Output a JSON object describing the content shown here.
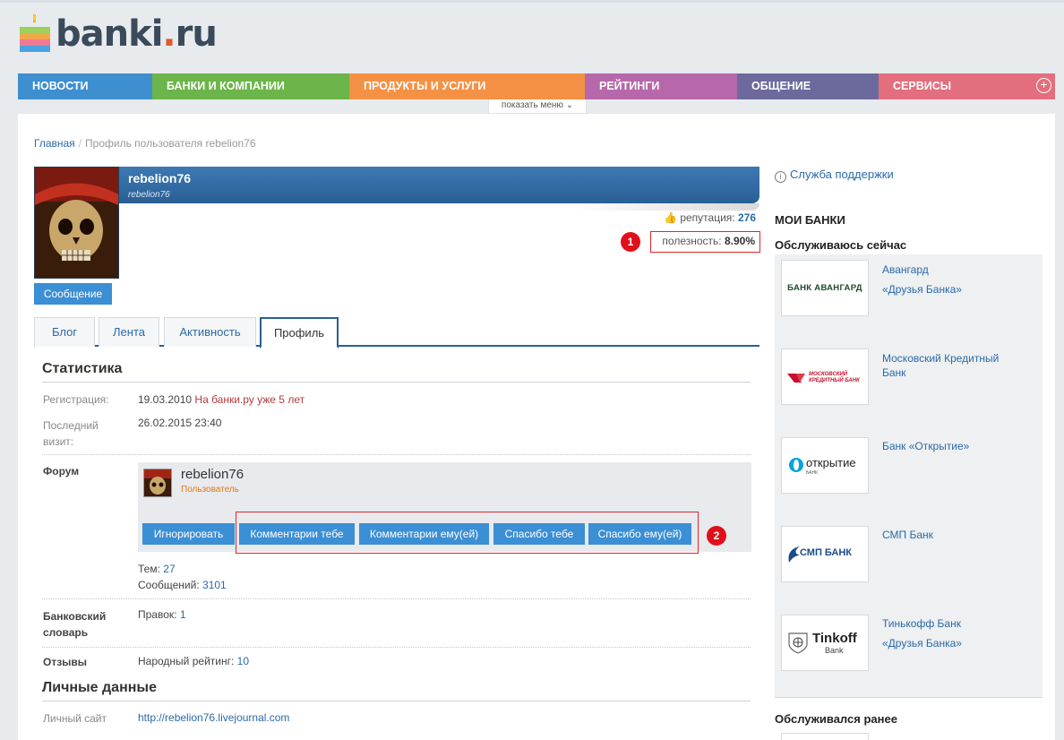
{
  "logo": {
    "name": "banki",
    "dot": ".",
    "tld": "ru"
  },
  "menu": {
    "items": [
      {
        "label": "НОВОСТИ",
        "color": "#3e8fd0",
        "width": 150
      },
      {
        "label": "БАНКИ И КОМПАНИИ",
        "color": "#6cb54a",
        "width": 220
      },
      {
        "label": "ПРОДУКТЫ И УСЛУГИ",
        "color": "#f59144",
        "width": 263
      },
      {
        "label": "РЕЙТИНГИ",
        "color": "#b668aa",
        "width": 170
      },
      {
        "label": "ОБЩЕНИЕ",
        "color": "#6c6a9d",
        "width": 158
      },
      {
        "label": "СЕРВИСЫ",
        "color": "#e36e7e",
        "width": 197
      }
    ],
    "plus": "+",
    "show_menu": "показать меню"
  },
  "breadcrumb": {
    "home": "Главная",
    "sep": "/",
    "current": "Профиль пользователя rebelion76"
  },
  "profile": {
    "name": "rebelion76",
    "login": "rebelion76",
    "reputation_label": "репутация:",
    "reputation_value": "276",
    "usefulness_label": "полезность:",
    "usefulness_value": "8.90%",
    "message_button": "Сообщение"
  },
  "markers": {
    "one": "1",
    "two": "2"
  },
  "tabs": [
    "Блог",
    "Лента",
    "Активность",
    "Профиль"
  ],
  "stats": {
    "title": "Статистика",
    "registration_label": "Регистрация:",
    "registration_date": "19.03.2010",
    "registration_note": "На банки.ру уже 5 лет",
    "last_visit_label_1": "Последний",
    "last_visit_label_2": "визит:",
    "last_visit_value": "26.02.2015 23:40",
    "forum_label": "Форум",
    "forum_user": "rebelion76",
    "forum_role": "Пользователь",
    "buttons": [
      "Игнорировать",
      "Комментарии тебе",
      "Комментарии ему(ей)",
      "Спасибо тебе",
      "Спасибо ему(ей)"
    ],
    "topics_label": "Тем:",
    "topics_value": "27",
    "messages_label": "Сообщений:",
    "messages_value": "3101",
    "dictionary_label_1": "Банковский",
    "dictionary_label_2": "словарь",
    "edits_label": "Правок:",
    "edits_value": "1",
    "reviews_label": "Отзывы",
    "rating_label": "Народный рейтинг:",
    "rating_value": "10"
  },
  "personal": {
    "title": "Личные данные",
    "site_label": "Личный сайт",
    "site_value": "http://rebelion76.livejournal.com"
  },
  "sidebar": {
    "support": "Служба поддержки",
    "my_banks": "МОИ БАНКИ",
    "serving_now": "Обслуживаюсь сейчас",
    "banks": [
      {
        "name": "Авангард",
        "sub": "«Друзья Банка»",
        "logo_text": "БАНК АВАНГАРД"
      },
      {
        "name": "Московский Кредитный Банк",
        "sub": "",
        "logo_text_1": "МОСКОВСКИЙ",
        "logo_text_2": "КРЕДИТНЫЙ БАНК"
      },
      {
        "name": "Банк «Открытие»",
        "sub": "",
        "logo_text_1": "открытие",
        "logo_text_2": "БАНК"
      },
      {
        "name": "СМП Банк",
        "sub": "",
        "logo_text": "СМП БАНК"
      },
      {
        "name": "Тинькофф Банк",
        "sub": "«Друзья Банка»",
        "logo_text_1": "Tinkoff",
        "logo_text_2": "Bank"
      }
    ],
    "served_before": "Обслуживался ранее"
  }
}
